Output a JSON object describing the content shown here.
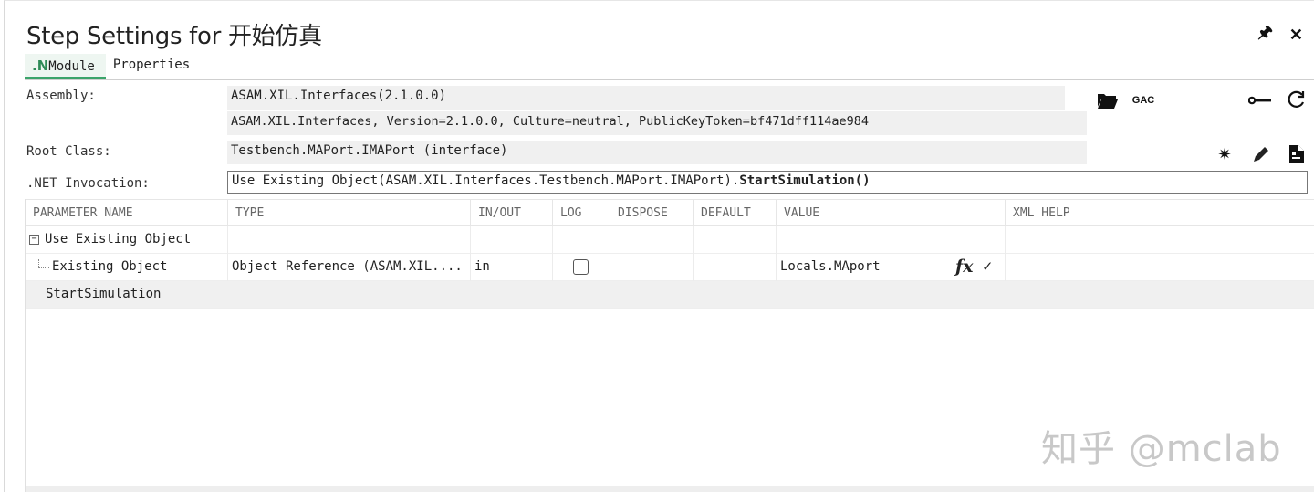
{
  "window": {
    "title": "Step Settings for 开始仿真",
    "pin_glyph": "🖈",
    "close_glyph": "✕"
  },
  "tabs": [
    {
      "logo": ".N",
      "label": "Module",
      "active": true
    },
    {
      "label": "Properties",
      "active": false
    }
  ],
  "form": {
    "assembly_label": "Assembly:",
    "assembly_value": "ASAM.XIL.Interfaces(2.1.0.0)",
    "assembly_fullname": "ASAM.XIL.Interfaces, Version=2.1.0.0, Culture=neutral, PublicKeyToken=bf471dff114ae984",
    "root_class_label": "Root Class:",
    "root_class_value": "Testbench.MAPort.IMAPort (interface)",
    "invocation_label": ".NET Invocation:",
    "invocation_prefix": "Use Existing Object(ASAM.XIL.Interfaces.Testbench.MAPort.IMAPort).",
    "invocation_method": "StartSimulation()",
    "gac_label": "GAC"
  },
  "grid": {
    "columns": [
      "PARAMETER NAME",
      "TYPE",
      "IN/OUT",
      "LOG",
      "DISPOSE",
      "DEFAULT",
      "VALUE",
      "XML HELP"
    ],
    "rows": [
      {
        "name": "Use Existing Object",
        "expander": "−"
      },
      {
        "name": "Existing Object",
        "type": "Object Reference (ASAM.XIL....",
        "inout": "in",
        "log": false,
        "value": "Locals.MAport",
        "fx": "fx",
        "check": "✓"
      },
      {
        "name": "StartSimulation"
      }
    ]
  },
  "watermark": "知乎 @mclab"
}
